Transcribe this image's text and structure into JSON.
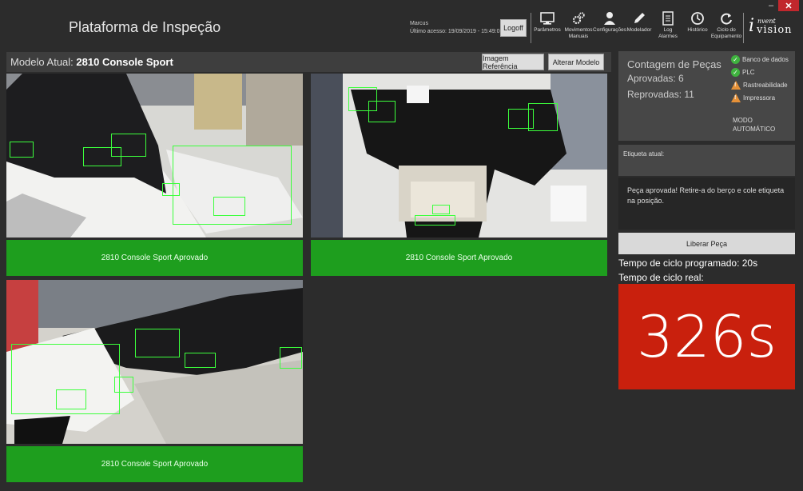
{
  "window": {
    "minimize": "–",
    "close": "✕"
  },
  "app_title": "Plataforma de Inspeção",
  "user": {
    "name": "Marcus",
    "last_access": "Último acesso: 19/09/2019 - 15:49:05"
  },
  "logoff_label": "Logoff",
  "toolbar": [
    {
      "label": "Parâmetros",
      "icon": "monitor-icon"
    },
    {
      "label": "Movimentos Manuais",
      "icon": "gears-icon"
    },
    {
      "label": "Configurações",
      "icon": "user-icon"
    },
    {
      "label": "Modelador",
      "icon": "pencil-icon"
    },
    {
      "label": "Log Alarmes",
      "icon": "document-icon"
    },
    {
      "label": "Histórico",
      "icon": "clock-icon"
    },
    {
      "label": "Ciclo do Equipamento",
      "icon": "refresh-icon"
    }
  ],
  "logo": {
    "letter": "i",
    "top": "nvent",
    "bottom": "vision"
  },
  "model": {
    "prefix": "Modelo Atual:",
    "name": "2810 Console Sport"
  },
  "buttons": {
    "reference_image": "Imagem Referência",
    "change_model": "Alterar Modelo",
    "release": "Liberar Peça"
  },
  "cameras": [
    {
      "status": "2810 Console Sport Aprovado"
    },
    {
      "status": "2810 Console Sport Aprovado"
    },
    {
      "status": "2810 Console Sport Aprovado"
    }
  ],
  "counts": {
    "title": "Contagem de Peças",
    "approved": "Aprovadas: 6",
    "rejected": "Reprovadas: 11"
  },
  "system_status": [
    {
      "label": "Banco de dados",
      "state": "ok"
    },
    {
      "label": "PLC",
      "state": "ok"
    },
    {
      "label": "Rastreabilidade",
      "state": "warning"
    },
    {
      "label": "Impressora",
      "state": "warning"
    }
  ],
  "mode": {
    "line1": "MODO",
    "line2": "AUTOMÁTICO"
  },
  "label_panel": {
    "title": "Etiqueta atual:"
  },
  "message": "Peça aprovada! Retire-a do berço e cole etiqueta na posição.",
  "cycle": {
    "programmed": "Tempo de ciclo programado: 20s",
    "real_label": "Tempo de ciclo real:",
    "real_value": "326s"
  },
  "colors": {
    "approved": "#1e9e1e",
    "timer_bg": "#c9200d",
    "detection": "#3cff3c"
  }
}
